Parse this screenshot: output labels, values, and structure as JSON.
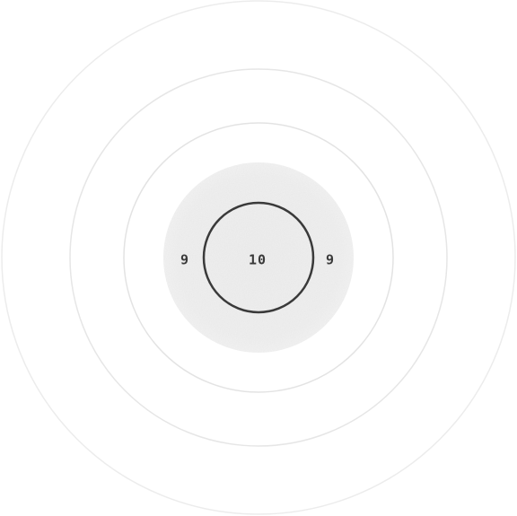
{
  "target": {
    "outer_ring_color": "#ececec",
    "mid_ring_color": "#e6e6e6",
    "inner_ring_color": "#e3e3e3",
    "center_fill_color": "#eeeeee",
    "ten_ring_stroke_color": "#3a3a3a",
    "labels": {
      "left_nine": "9",
      "center_ten": "10",
      "right_nine": "9"
    }
  }
}
